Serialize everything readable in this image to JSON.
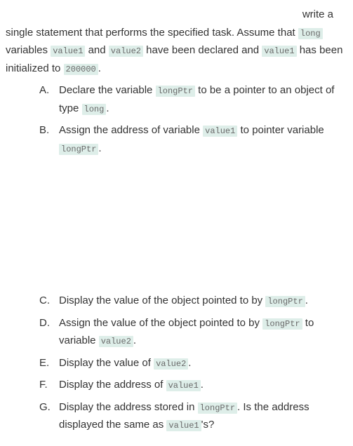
{
  "intro": {
    "line1_right": "write a",
    "line2a": "single statement that performs the specified task. Assume that ",
    "code_long": "long",
    "line2b": " variables ",
    "code_value1": "value1",
    "line2c": " and ",
    "code_value2": "value2",
    "line2d": " have been declared and ",
    "line3a": " has been initialized to ",
    "code_200000": "200000",
    "line3b": "."
  },
  "items": {
    "A": {
      "marker": "A.",
      "t1": "Declare the variable ",
      "c1": "longPtr",
      "t2": " to be a pointer to an object of type ",
      "c2": "long",
      "t3": "."
    },
    "B": {
      "marker": "B.",
      "t1": "Assign the address of variable ",
      "c1": "value1",
      "t2": " to pointer variable ",
      "c2": "longPtr",
      "t3": "."
    },
    "C": {
      "marker": "C.",
      "t1": "Display the value of the object pointed to by ",
      "c1": "longPtr",
      "t2": "."
    },
    "D": {
      "marker": "D.",
      "t1": "Assign the value of the object pointed to by ",
      "c1": "longPtr",
      "t2": " to variable ",
      "c2": "value2",
      "t3": "."
    },
    "E": {
      "marker": "E.",
      "t1": "Display the value of ",
      "c1": "value2",
      "t2": "."
    },
    "F": {
      "marker": "F.",
      "t1": "Display the address of ",
      "c1": "value1",
      "t2": "."
    },
    "G": {
      "marker": "G.",
      "t1": "Display the address stored in ",
      "c1": "longPtr",
      "t2": ". Is the address displayed the same as ",
      "c2": "value1",
      "t3": "'s?"
    }
  }
}
